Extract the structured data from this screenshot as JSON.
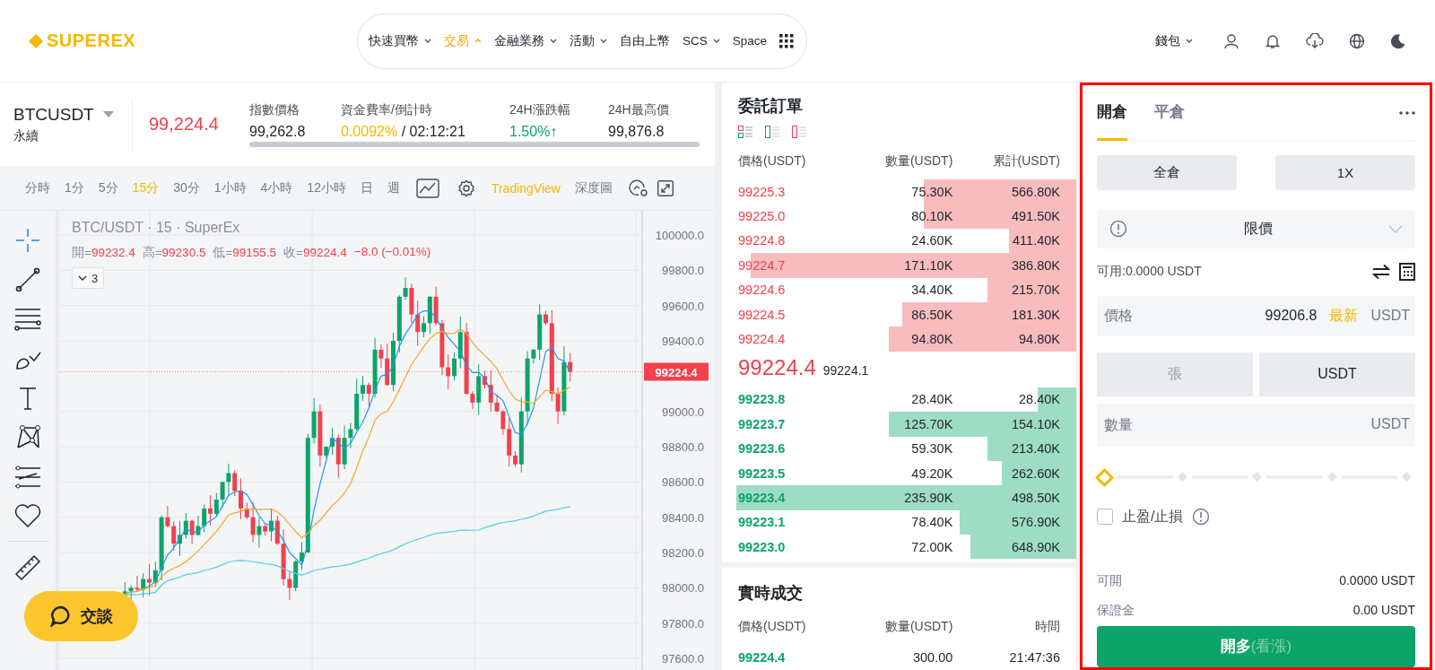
{
  "header": {
    "logo": "SUPEREX",
    "nav": [
      {
        "label": "快速買幣",
        "dropdown": true,
        "selected": false,
        "expanded": false
      },
      {
        "label": "交易",
        "dropdown": true,
        "selected": true,
        "expanded": true
      },
      {
        "label": "金融業務",
        "dropdown": true,
        "selected": false,
        "expanded": false
      },
      {
        "label": "活動",
        "dropdown": true,
        "selected": false,
        "expanded": false
      },
      {
        "label": "自由上幣",
        "dropdown": false,
        "selected": false
      },
      {
        "label": "SCS",
        "dropdown": true,
        "selected": false,
        "expanded": false
      },
      {
        "label": "Space",
        "dropdown": false,
        "selected": false
      }
    ],
    "wallet": "錢包"
  },
  "ticker": {
    "symbol": "BTCUSDT",
    "contract": "永續",
    "price": "99,224.4",
    "stats": [
      {
        "label": "指數價格",
        "kind": "plain",
        "value": "99,262.8"
      },
      {
        "label": "資金費率/倒計時",
        "kind": "rate",
        "value": "0.0092%",
        "extra": "/ 02:12:21"
      },
      {
        "label": "24H漲跌幅",
        "kind": "up",
        "value": "1.50%↑"
      },
      {
        "label": "24H最高價",
        "kind": "plain",
        "value": "99,876.8"
      }
    ]
  },
  "toolbar": {
    "intervals": [
      {
        "label": "分時",
        "selected": false
      },
      {
        "label": "1分",
        "selected": false
      },
      {
        "label": "5分",
        "selected": false
      },
      {
        "label": "15分",
        "selected": true
      },
      {
        "label": "30分",
        "selected": false
      },
      {
        "label": "1小時",
        "selected": false
      },
      {
        "label": "4小時",
        "selected": false
      },
      {
        "label": "12小時",
        "selected": false
      },
      {
        "label": "日",
        "selected": false
      },
      {
        "label": "週",
        "selected": false
      }
    ],
    "views": [
      {
        "label": "TradingView",
        "selected": true
      },
      {
        "label": "深度圖",
        "selected": false
      }
    ]
  },
  "chart": {
    "title": "BTC/USDT · 15 · SuperEx",
    "ohlc": [
      {
        "label": "開=",
        "value": "99232.4"
      },
      {
        "label": "高=",
        "value": "99230.5"
      },
      {
        "label": "低=",
        "value": "99155.5"
      },
      {
        "label": "收=",
        "value": "99224.4"
      }
    ],
    "change": "−8.0 (−0.01%)",
    "indicator_count": "3",
    "price_labels": [
      "100000.0",
      "99800.0",
      "99600.0",
      "99400.0",
      "99000.0",
      "98800.0",
      "98600.0",
      "98400.0",
      "98200.0",
      "98000.0",
      "97800.0",
      "97600.0"
    ],
    "last_price": "99224.4"
  },
  "chat_button": "交談",
  "order_book": {
    "title": "委託訂單",
    "columns": [
      "價格(USDT)",
      "數量(USDT)",
      "累計(USDT)"
    ],
    "asks": [
      {
        "price": "99225.3",
        "qty": "75.30K",
        "total": "566.80K",
        "level": 0.43
      },
      {
        "price": "99225.0",
        "qty": "80.10K",
        "total": "491.50K",
        "level": 0.43
      },
      {
        "price": "99224.8",
        "qty": "24.60K",
        "total": "411.40K",
        "level": 0.19
      },
      {
        "price": "99224.7",
        "qty": "171.10K",
        "total": "386.80K",
        "level": 0.92
      },
      {
        "price": "99224.6",
        "qty": "34.40K",
        "total": "215.70K",
        "level": 0.25
      },
      {
        "price": "99224.5",
        "qty": "86.50K",
        "total": "181.30K",
        "level": 0.49
      },
      {
        "price": "99224.4",
        "qty": "94.80K",
        "total": "94.80K",
        "level": 0.53
      }
    ],
    "last_price": "99224.4",
    "mark_price": "99224.1",
    "bids": [
      {
        "price": "99223.8",
        "qty": "28.40K",
        "total": "28.40K",
        "level": 0.11
      },
      {
        "price": "99223.7",
        "qty": "125.70K",
        "total": "154.10K",
        "level": 0.53
      },
      {
        "price": "99223.6",
        "qty": "59.30K",
        "total": "213.40K",
        "level": 0.25
      },
      {
        "price": "99223.5",
        "qty": "49.20K",
        "total": "262.60K",
        "level": 0.21
      },
      {
        "price": "99223.4",
        "qty": "235.90K",
        "total": "498.50K",
        "level": 0.96
      },
      {
        "price": "99223.1",
        "qty": "78.40K",
        "total": "576.90K",
        "level": 0.33
      },
      {
        "price": "99223.0",
        "qty": "72.00K",
        "total": "648.90K",
        "level": 0.3
      }
    ]
  },
  "trades": {
    "title": "實時成交",
    "columns": [
      "價格(USDT)",
      "數量(USDT)",
      "時間"
    ],
    "rows": [
      {
        "price": "99224.4",
        "qty": "300.00",
        "time": "21:47:36"
      }
    ]
  },
  "trade_panel": {
    "highlighted": true,
    "tabs": [
      {
        "label": "開倉",
        "selected": true
      },
      {
        "label": "平倉",
        "selected": false
      }
    ],
    "margin_mode": "全倉",
    "leverage": "1X",
    "order_type": "限價",
    "available": "可用:0.0000 USDT",
    "price_field": {
      "label": "價格",
      "value": "99206.8",
      "latest": "最新",
      "unit": "USDT"
    },
    "unit_toggle": [
      {
        "label": "張",
        "selected": false
      },
      {
        "label": "USDT",
        "selected": true
      }
    ],
    "quantity_field": {
      "placeholder": "數量",
      "unit": "USDT"
    },
    "slider": {
      "level": 0
    },
    "tpsl": {
      "label": "止盈/止損",
      "checked": false
    },
    "info": [
      {
        "label": "可開",
        "value": "0.0000 USDT"
      },
      {
        "label": "保證金",
        "value": "0.00 USDT"
      }
    ],
    "submit": {
      "label": "開多",
      "hint": "(看漲)"
    }
  }
}
